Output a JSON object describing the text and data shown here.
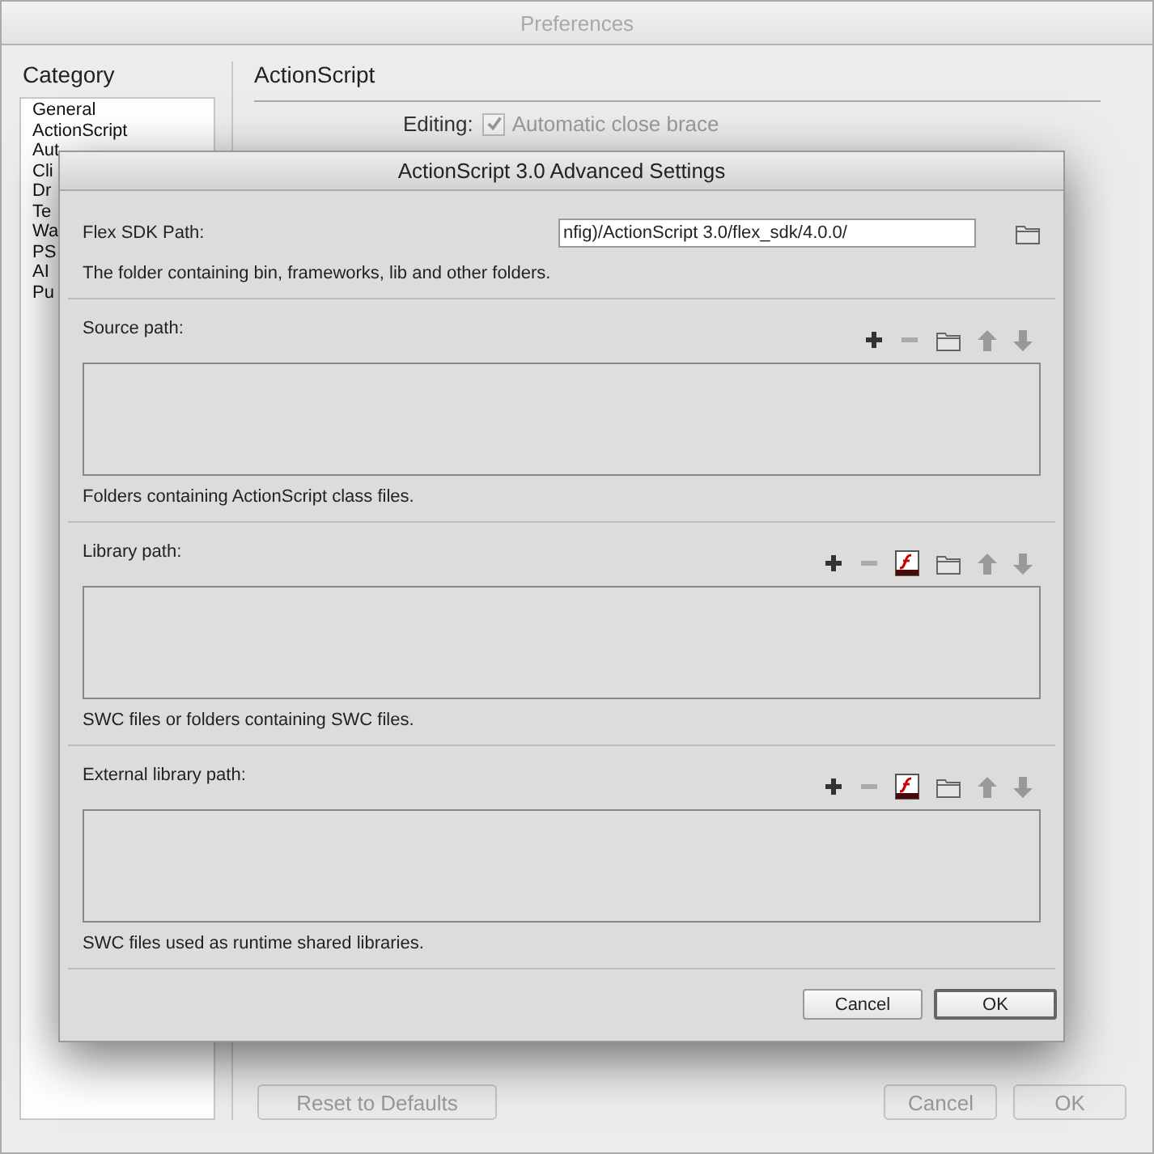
{
  "window": {
    "title": "Preferences"
  },
  "sidebar": {
    "heading": "Category",
    "items": [
      {
        "label": "General",
        "selected": false
      },
      {
        "label": "ActionScript",
        "selected": false
      },
      {
        "label": "Aut",
        "selected": false
      },
      {
        "label": "Cli",
        "selected": false
      },
      {
        "label": "Dr",
        "selected": false
      },
      {
        "label": "Te",
        "selected": false
      },
      {
        "label": "Wa",
        "selected": false
      },
      {
        "label": "PS",
        "selected": false
      },
      {
        "label": "AI",
        "selected": false
      },
      {
        "label": "Pu",
        "selected": false
      }
    ]
  },
  "panel": {
    "heading": "ActionScript",
    "editing_label": "Editing:",
    "option": {
      "label": "Automatic close brace",
      "checked": true,
      "disabled": true
    }
  },
  "footer": {
    "reset": "Reset to Defaults",
    "buttons": [
      "Cancel",
      "OK"
    ]
  },
  "dialog": {
    "title": "ActionScript 3.0 Advanced Settings",
    "sdk": {
      "label": "Flex SDK Path:",
      "value": "nfig)/ActionScript 3.0/flex_sdk/4.0.0/",
      "hint": "The folder containing bin, frameworks, lib and other folders."
    },
    "sections": [
      {
        "label": "Source path:",
        "hint": "Folders containing ActionScript class files.",
        "tools": [
          {
            "kind": "add",
            "disabled": false
          },
          {
            "kind": "remove",
            "disabled": true
          },
          {
            "kind": "folder",
            "disabled": false
          },
          {
            "kind": "up",
            "disabled": true
          },
          {
            "kind": "down",
            "disabled": true
          }
        ]
      },
      {
        "label": "Library path:",
        "hint": "SWC files or folders containing SWC files.",
        "tools": [
          {
            "kind": "add",
            "disabled": false
          },
          {
            "kind": "remove",
            "disabled": true
          },
          {
            "kind": "flash",
            "disabled": false
          },
          {
            "kind": "folder",
            "disabled": false
          },
          {
            "kind": "up",
            "disabled": true
          },
          {
            "kind": "down",
            "disabled": true
          }
        ]
      },
      {
        "label": "External library path:",
        "hint": "SWC files used as runtime shared libraries.",
        "tools": [
          {
            "kind": "add",
            "disabled": false
          },
          {
            "kind": "remove",
            "disabled": true
          },
          {
            "kind": "flash",
            "disabled": false
          },
          {
            "kind": "folder",
            "disabled": false
          },
          {
            "kind": "up",
            "disabled": true
          },
          {
            "kind": "down",
            "disabled": true
          }
        ]
      }
    ],
    "buttons": [
      {
        "label": "Cancel",
        "default": false
      },
      {
        "label": "OK",
        "default": true
      }
    ]
  }
}
